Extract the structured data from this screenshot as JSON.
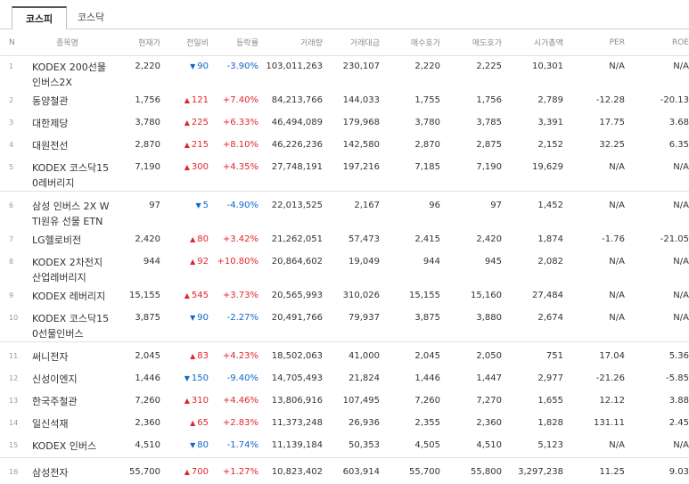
{
  "tabs": {
    "kospi": "코스피",
    "kosdaq": "코스닥"
  },
  "headers": {
    "n": "N",
    "name": "종목명",
    "price": "현재가",
    "change": "전일비",
    "rate": "등락률",
    "volume": "거래량",
    "amount": "거래대금",
    "bid": "매수호가",
    "ask": "매도호가",
    "mcap": "시가총액",
    "per": "PER",
    "roe": "ROE"
  },
  "rows": [
    {
      "n": "1",
      "name": "KODEX 200선물인버스2X",
      "price": "2,220",
      "dir": "down",
      "change": "90",
      "rate": "-3.90%",
      "volume": "103,011,263",
      "amount": "230,107",
      "bid": "2,220",
      "ask": "2,225",
      "mcap": "10,301",
      "per": "N/A",
      "roe": "N/A"
    },
    {
      "n": "2",
      "name": "동양철관",
      "price": "1,756",
      "dir": "up",
      "change": "121",
      "rate": "+7.40%",
      "volume": "84,213,766",
      "amount": "144,033",
      "bid": "1,755",
      "ask": "1,756",
      "mcap": "2,789",
      "per": "-12.28",
      "roe": "-20.13"
    },
    {
      "n": "3",
      "name": "대한제당",
      "price": "3,780",
      "dir": "up",
      "change": "225",
      "rate": "+6.33%",
      "volume": "46,494,089",
      "amount": "179,968",
      "bid": "3,780",
      "ask": "3,785",
      "mcap": "3,391",
      "per": "17.75",
      "roe": "3.68"
    },
    {
      "n": "4",
      "name": "대원전선",
      "price": "2,870",
      "dir": "up",
      "change": "215",
      "rate": "+8.10%",
      "volume": "46,226,236",
      "amount": "142,580",
      "bid": "2,870",
      "ask": "2,875",
      "mcap": "2,152",
      "per": "32.25",
      "roe": "6.35"
    },
    {
      "n": "5",
      "name": "KODEX 코스닥150레버리지",
      "price": "7,190",
      "dir": "up",
      "change": "300",
      "rate": "+4.35%",
      "volume": "27,748,191",
      "amount": "197,216",
      "bid": "7,185",
      "ask": "7,190",
      "mcap": "19,629",
      "per": "N/A",
      "roe": "N/A"
    },
    {
      "n": "6",
      "name": "삼성 인버스 2X WTI원유 선물 ETN",
      "price": "97",
      "dir": "down",
      "change": "5",
      "rate": "-4.90%",
      "volume": "22,013,525",
      "amount": "2,167",
      "bid": "96",
      "ask": "97",
      "mcap": "1,452",
      "per": "N/A",
      "roe": "N/A"
    },
    {
      "n": "7",
      "name": "LG헬로비전",
      "price": "2,420",
      "dir": "up",
      "change": "80",
      "rate": "+3.42%",
      "volume": "21,262,051",
      "amount": "57,473",
      "bid": "2,415",
      "ask": "2,420",
      "mcap": "1,874",
      "per": "-1.76",
      "roe": "-21.05"
    },
    {
      "n": "8",
      "name": "KODEX 2차전지산업레버리지",
      "price": "944",
      "dir": "up",
      "change": "92",
      "rate": "+10.80%",
      "volume": "20,864,602",
      "amount": "19,049",
      "bid": "944",
      "ask": "945",
      "mcap": "2,082",
      "per": "N/A",
      "roe": "N/A"
    },
    {
      "n": "9",
      "name": "KODEX 레버리지",
      "price": "15,155",
      "dir": "up",
      "change": "545",
      "rate": "+3.73%",
      "volume": "20,565,993",
      "amount": "310,026",
      "bid": "15,155",
      "ask": "15,160",
      "mcap": "27,484",
      "per": "N/A",
      "roe": "N/A"
    },
    {
      "n": "10",
      "name": "KODEX 코스닥150선물인버스",
      "price": "3,875",
      "dir": "down",
      "change": "90",
      "rate": "-2.27%",
      "volume": "20,491,766",
      "amount": "79,937",
      "bid": "3,875",
      "ask": "3,880",
      "mcap": "2,674",
      "per": "N/A",
      "roe": "N/A"
    },
    {
      "n": "11",
      "name": "써니전자",
      "price": "2,045",
      "dir": "up",
      "change": "83",
      "rate": "+4.23%",
      "volume": "18,502,063",
      "amount": "41,000",
      "bid": "2,045",
      "ask": "2,050",
      "mcap": "751",
      "per": "17.04",
      "roe": "5.36"
    },
    {
      "n": "12",
      "name": "신성이엔지",
      "price": "1,446",
      "dir": "down",
      "change": "150",
      "rate": "-9.40%",
      "volume": "14,705,493",
      "amount": "21,824",
      "bid": "1,446",
      "ask": "1,447",
      "mcap": "2,977",
      "per": "-21.26",
      "roe": "-5.85"
    },
    {
      "n": "13",
      "name": "한국주철관",
      "price": "7,260",
      "dir": "up",
      "change": "310",
      "rate": "+4.46%",
      "volume": "13,806,916",
      "amount": "107,495",
      "bid": "7,260",
      "ask": "7,270",
      "mcap": "1,655",
      "per": "12.12",
      "roe": "3.88"
    },
    {
      "n": "14",
      "name": "일신석재",
      "price": "2,360",
      "dir": "up",
      "change": "65",
      "rate": "+2.83%",
      "volume": "11,373,248",
      "amount": "26,936",
      "bid": "2,355",
      "ask": "2,360",
      "mcap": "1,828",
      "per": "131.11",
      "roe": "2.45"
    },
    {
      "n": "15",
      "name": "KODEX 인버스",
      "price": "4,510",
      "dir": "down",
      "change": "80",
      "rate": "-1.74%",
      "volume": "11,139,184",
      "amount": "50,353",
      "bid": "4,505",
      "ask": "4,510",
      "mcap": "5,123",
      "per": "N/A",
      "roe": "N/A"
    },
    {
      "n": "16",
      "name": "삼성전자",
      "price": "55,700",
      "dir": "up",
      "change": "700",
      "rate": "+1.27%",
      "volume": "10,823,402",
      "amount": "603,914",
      "bid": "55,700",
      "ask": "55,800",
      "mcap": "3,297,238",
      "per": "11.25",
      "roe": "9.03"
    }
  ],
  "colors": {
    "up": "#e0262b",
    "down": "#1266c7"
  }
}
